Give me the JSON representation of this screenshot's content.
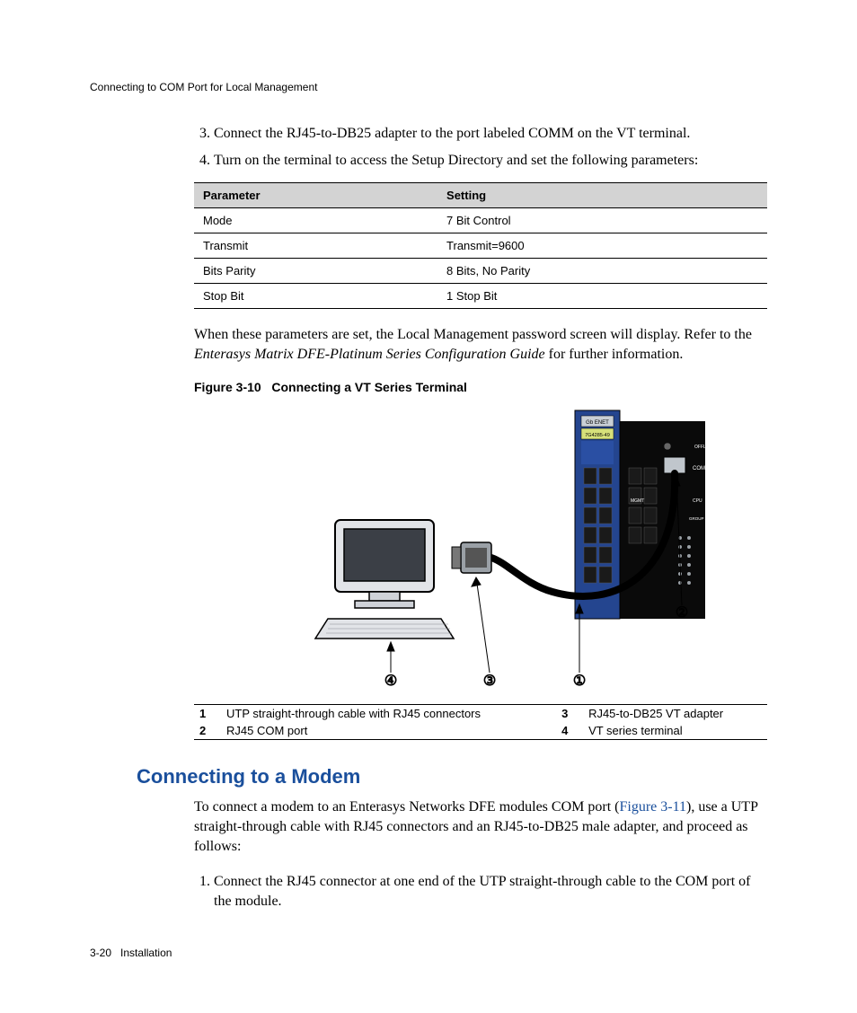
{
  "running_header": "Connecting to COM Port for Local Management",
  "steps_a": {
    "start": 3,
    "items": [
      "Connect the RJ45-to-DB25 adapter to the port labeled COMM on the VT terminal.",
      "Turn on the terminal to access the Setup Directory and set the following parameters:"
    ]
  },
  "param_table": {
    "headers": [
      "Parameter",
      "Setting"
    ],
    "rows": [
      [
        "Mode",
        "7 Bit Control"
      ],
      [
        "Transmit",
        "Transmit=9600"
      ],
      [
        "Bits Parity",
        "8 Bits, No Parity"
      ],
      [
        "Stop Bit",
        "1 Stop Bit"
      ]
    ]
  },
  "after_table_p1": "When these parameters are set, the Local Management password screen will display. Refer to the ",
  "after_table_em": "Enterasys Matrix DFE-Platinum Series Configuration Guide",
  "after_table_p2": " for further information.",
  "figure": {
    "label": "Figure 3-10",
    "title": "Connecting a VT Series Terminal",
    "device_label_top": "Gb ENET",
    "device_label_bottom": "7G4285-49",
    "port_labels": {
      "offline": "OFFLINE RESET",
      "com": "COM",
      "mgmt": "MGMT",
      "cpu": "CPU",
      "group": "GROUP SELECT"
    },
    "callouts": {
      "1": "1",
      "2": "2",
      "3": "3",
      "4": "4"
    },
    "callout_glyphs": {
      "1": "①",
      "2": "②",
      "3": "③",
      "4": "④"
    }
  },
  "legend": [
    {
      "n": "1",
      "text": "UTP straight-through cable with RJ45 connectors"
    },
    {
      "n": "2",
      "text": "RJ45 COM port"
    },
    {
      "n": "3",
      "text": "RJ45-to-DB25 VT adapter"
    },
    {
      "n": "4",
      "text": "VT series terminal"
    }
  ],
  "section_heading": "Connecting to a Modem",
  "modem_intro_1": "To connect a modem to an Enterasys Networks DFE modules COM port (",
  "modem_intro_link": "Figure 3-11",
  "modem_intro_2": "), use a UTP straight-through cable with RJ45 connectors and an RJ45-to-DB25 male adapter, and proceed as follows:",
  "steps_b": {
    "start": 1,
    "items": [
      "Connect the RJ45 connector at one end of the UTP straight-through cable to the COM port of the module."
    ]
  },
  "footer": {
    "page": "3-20",
    "section": "Installation"
  }
}
